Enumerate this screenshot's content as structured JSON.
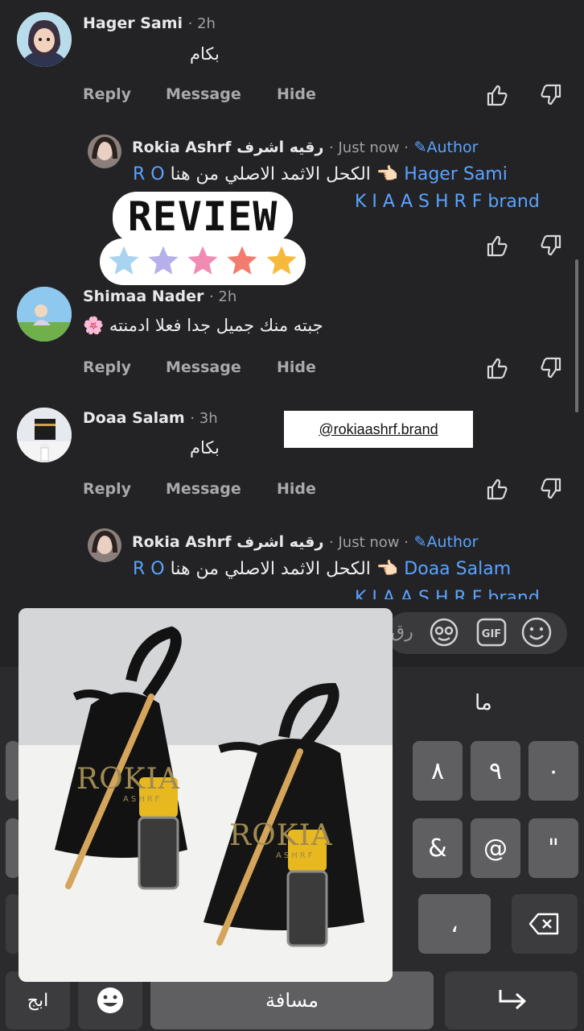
{
  "comments": [
    {
      "author": "Hager Sami",
      "time": "· 2h",
      "text": "بكام",
      "actions": {
        "reply": "Reply",
        "message": "Message",
        "hide": "Hide"
      }
    },
    {
      "author": "Shimaa Nader",
      "time": "· 2h",
      "text": "جبته منك جميل جدا فعلا ادمنته 🌸",
      "actions": {
        "reply": "Reply",
        "message": "Message",
        "hide": "Hide"
      }
    },
    {
      "author": "Doaa Salam",
      "time": "· 3h",
      "text": "بكام",
      "actions": {
        "reply": "Reply",
        "message": "Message",
        "hide": "Hide"
      }
    }
  ],
  "replies": [
    {
      "author": "Rokia Ashrf رقيه اشرف",
      "time": "· Just now ·",
      "badge": "Author",
      "mention": "Hager Sami",
      "line1_text": "الكحل الاثمد الاصلي من هنا 👈🏻",
      "line1_link": "R O",
      "line2_link": "K I A A S H R F brand"
    },
    {
      "author": "Rokia Ashrf رقيه اشرف",
      "time": "· Just now ·",
      "badge": "Author",
      "mention": "Doaa Salam",
      "line1_text": "الكحل الاثمد الاصلي من هنا 👈🏻",
      "line1_link": "R O",
      "line2_link": "K I A A S H R F brand"
    }
  ],
  "sticker": {
    "review": "REVIEW",
    "star_colors": [
      "#a8d4f0",
      "#b6b0ea",
      "#f08cb4",
      "#f27c6e",
      "#f7b93c"
    ]
  },
  "handle_tag": "@rokiaashrf.brand",
  "composer": {
    "placeholder": "رق"
  },
  "photo": {
    "bag_brand": "ROKIA",
    "bag_sub": "ASHRF"
  },
  "keyboard": {
    "suggestion": "ما",
    "row1": [
      "٨",
      "٩",
      "٠"
    ],
    "row2": [
      "&",
      "@",
      "\""
    ],
    "row3": [
      "،"
    ],
    "lang": "ابج",
    "space": "مسافة"
  },
  "colors": {
    "background": "#232325",
    "link": "#5aa3ff",
    "key": "#5f5f62"
  }
}
